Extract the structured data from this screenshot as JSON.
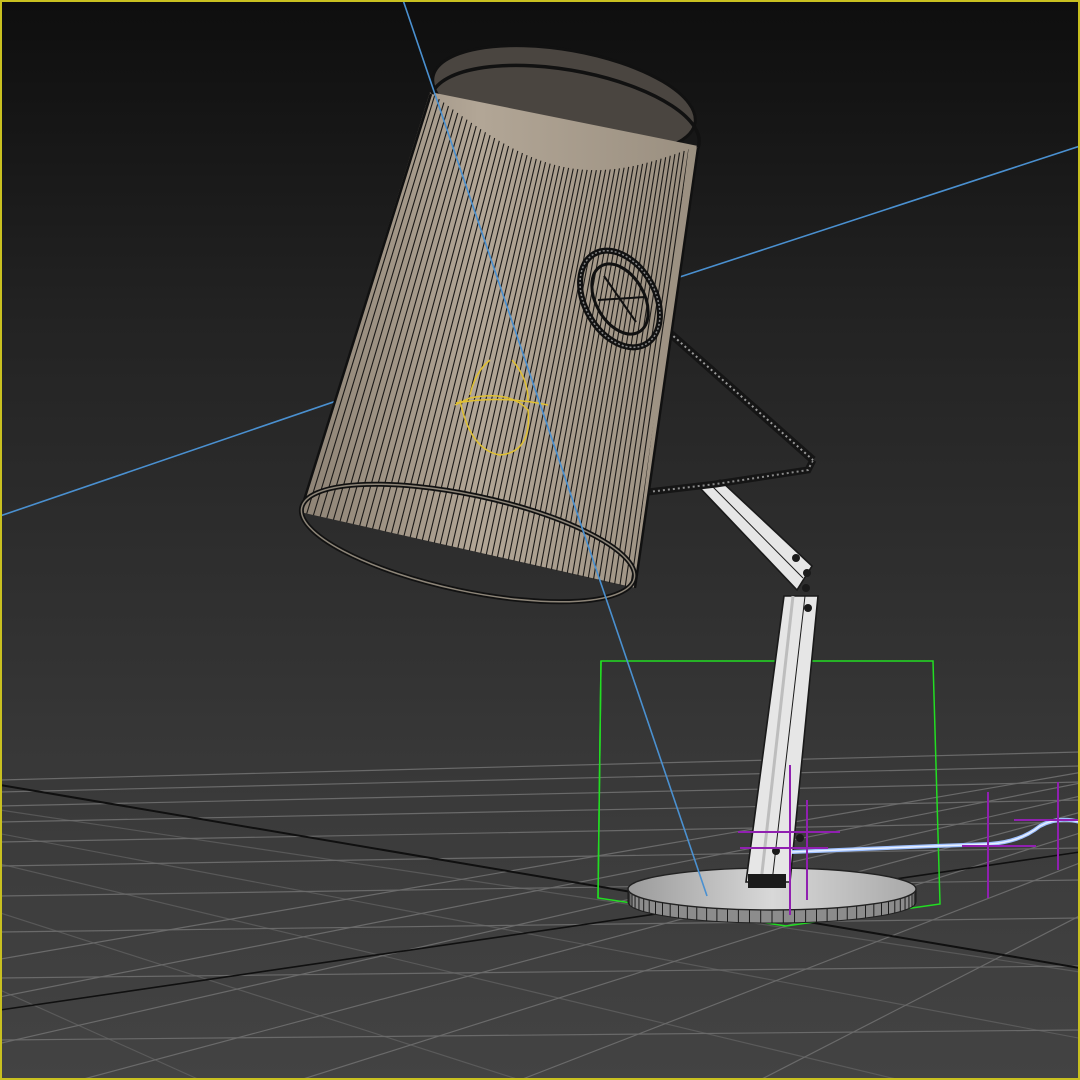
{
  "viewport": {
    "active_border_color": "#c8c020",
    "background_top": "#0e0e0e",
    "background_bottom": "#434343"
  },
  "scene": {
    "object": "desk-lamp",
    "display_mode": "wireframe-shaded",
    "grid_visible": true,
    "colors": {
      "shade_fill": "#a89c8c",
      "shade_lines": "#1c1a18",
      "arm_fill": "#e4e4e4",
      "base_fill": "#c9c9c9",
      "light_ray": "#4a90d0",
      "selection_box": "#22dd22",
      "light_target": "#e0c030",
      "bone_helper": "#9020b0",
      "cable": "#b8d4ff",
      "grid_line": "#6a6a6a",
      "grid_axis": "#101010"
    }
  }
}
